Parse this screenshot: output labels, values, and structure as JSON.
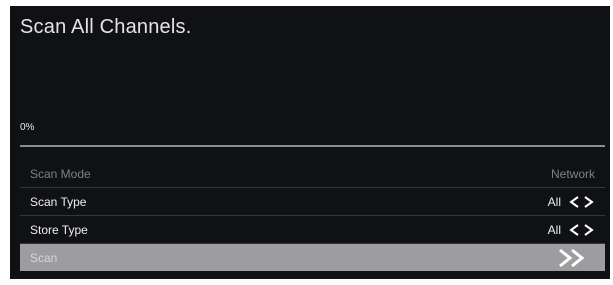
{
  "screen": {
    "title": "Scan All Channels.",
    "progress": {
      "label": "0%",
      "value": 0
    }
  },
  "menu": {
    "rows": [
      {
        "label": "Scan Mode",
        "value": "Network",
        "state": "disabled"
      },
      {
        "label": "Scan Type",
        "value": "All",
        "icon": "left-right-arrows-icon"
      },
      {
        "label": "Store Type",
        "value": "All",
        "icon": "left-right-arrows-icon"
      },
      {
        "label": "Scan",
        "icon": "double-chevron-right-icon",
        "state": "selected"
      }
    ]
  },
  "colors": {
    "background": "#101114",
    "selected_row": "#9d9d9f",
    "progress_track": "#8b8d91",
    "text": "#eeeeee",
    "disabled_text": "#7e8084"
  }
}
